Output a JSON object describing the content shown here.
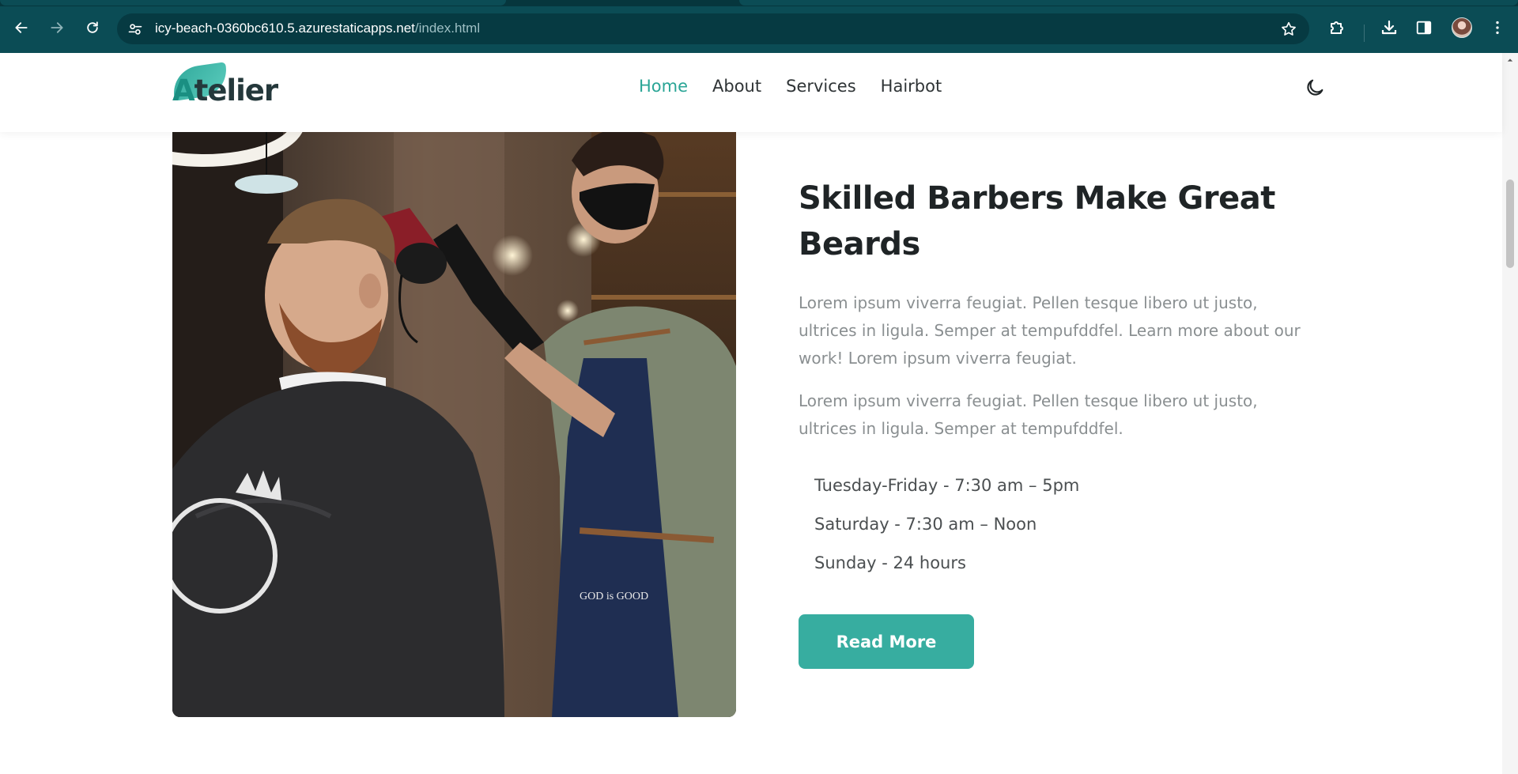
{
  "browser": {
    "url_host": "icy-beach-0360bc610.5.azurestaticapps.net",
    "url_path": "/index.html",
    "icons": {
      "back": "back-arrow-icon",
      "forward": "forward-arrow-icon",
      "reload": "reload-icon",
      "site_info": "site-settings-icon",
      "bookmark": "star-icon",
      "extensions": "puzzle-icon",
      "downloads": "download-icon",
      "side_panel": "side-panel-icon",
      "menu": "kebab-menu-icon"
    }
  },
  "site": {
    "logo_first": "A",
    "logo_rest": "telier",
    "nav": [
      {
        "label": "Home",
        "active": true
      },
      {
        "label": "About",
        "active": false
      },
      {
        "label": "Services",
        "active": false
      },
      {
        "label": "Hairbot",
        "active": false
      }
    ],
    "theme_icon": "moon-icon"
  },
  "section": {
    "heading": "Skilled Barbers Make Great Beards",
    "paragraph_1": "Lorem ipsum viverra feugiat. Pellen tesque libero ut justo, ultrices in ligula. Semper at tempufddfel. Learn more about our work! Lorem ipsum viverra feugiat.",
    "paragraph_2": "Lorem ipsum viverra feugiat. Pellen tesque libero ut justo, ultrices in ligula. Semper at tempufddfel.",
    "hours": [
      "Tuesday-Friday - 7:30 am – 5pm",
      "Saturday - 7:30 am – Noon",
      "Sunday - 24 hours"
    ],
    "button_label": "Read More",
    "photo_apron_text": "GOD is GOOD"
  },
  "colors": {
    "chrome": "#0b4c55",
    "accent": "#37ada0",
    "nav_active": "#2aa596",
    "heading": "#1f2426",
    "body_text": "#8a8f91"
  }
}
